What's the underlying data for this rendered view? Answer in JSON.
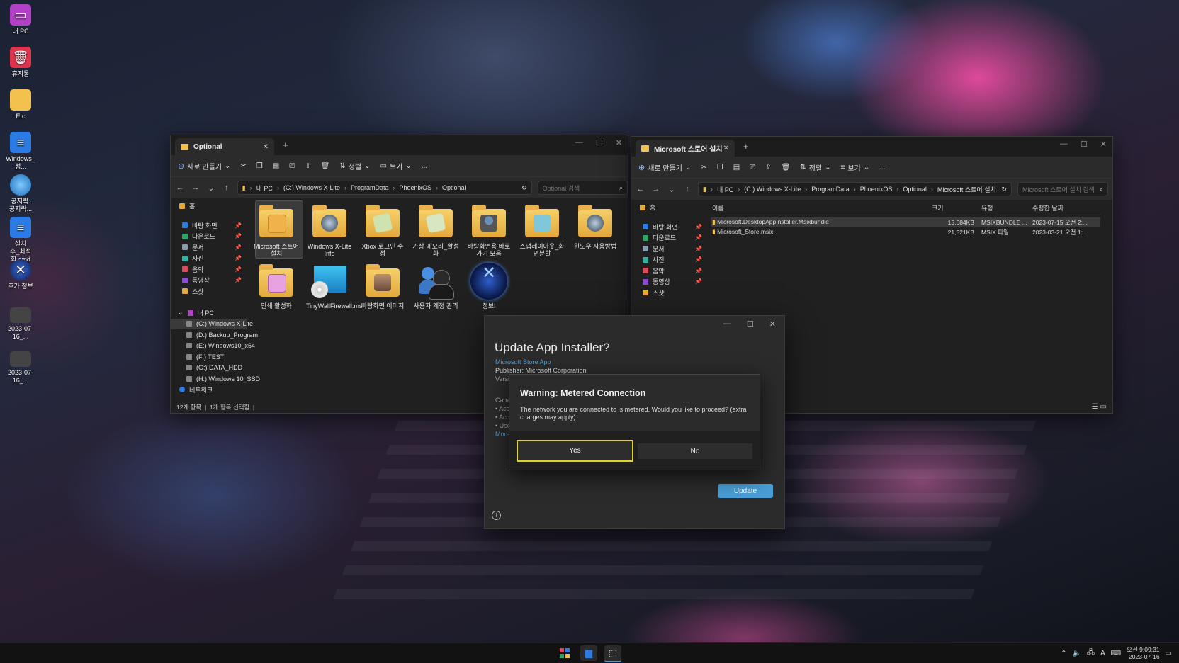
{
  "desktop_icons": [
    {
      "label": "내 PC",
      "icon": "monitor-icon"
    },
    {
      "label": "휴지통",
      "icon": "recycle-bin-icon"
    },
    {
      "label": "Etc",
      "icon": "folder-icon"
    },
    {
      "label": "Windows_정...",
      "icon": "document-icon"
    },
    {
      "label": "공지락.\n공지락...",
      "icon": "globe-icon"
    },
    {
      "label": "설치\n후_최적화.cmd",
      "icon": "document-icon"
    },
    {
      "label": "추가 정보",
      "icon": "info-badge-icon"
    },
    {
      "label": "2023-07-16_...",
      "icon": "screenshot-icon"
    },
    {
      "label": "2023-07-16_...",
      "icon": "screenshot-icon"
    }
  ],
  "left_window": {
    "tab_title": "Optional",
    "toolbar": {
      "new": "새로 만들기",
      "sort": "정렬",
      "view": "보기",
      "more": "..."
    },
    "breadcrumb": [
      "내 PC",
      "(C:) Windows X-Lite",
      "ProgramData",
      "PhoenixOS",
      "Optional"
    ],
    "search_placeholder": "Optional 검색",
    "sidebar": {
      "home": "홈",
      "quick": [
        "바탕 화면",
        "다운로드",
        "문서",
        "사진",
        "음악",
        "동영상",
        "스샷"
      ],
      "pc": "내 PC",
      "drives": [
        "(C:) Windows X-Lite",
        "(D:) Backup_Program",
        "(E:) Windows10_x64",
        "(F:) TEST",
        "(G:) DATA_HDD",
        "(H:) Windows 10_SSD"
      ],
      "network": "네트워크"
    },
    "items": [
      "Microsoft 스토어 설치",
      "Windows X-Lite Info",
      "Xbox 로그인 수정",
      "가상 메모리_활성화",
      "바탕화면용 바로가기 모음",
      "스냅레이아웃_화면분할",
      "윈도우 사용방법",
      "인쇄 활성화",
      "TinyWallFirewall.msi",
      "바탕화면 이미지",
      "사용자 계정 관리",
      "정보!"
    ],
    "status": {
      "count": "12개 항목",
      "selected": "1개 항목 선택함"
    }
  },
  "right_window": {
    "tab_title": "Microsoft 스토어 설치",
    "toolbar": {
      "new": "새로 만들기",
      "sort": "정렬",
      "view": "보기",
      "more": "..."
    },
    "breadcrumb": [
      "내 PC",
      "(C:) Windows X-Lite",
      "ProgramData",
      "PhoenixOS",
      "Optional",
      "Microsoft 스토어 설치"
    ],
    "search_placeholder": "Microsoft 스토어 설치 검색",
    "sidebar": {
      "home": "홈",
      "quick": [
        "바탕 화면",
        "다운로드",
        "문서",
        "사진",
        "음악",
        "동영상",
        "스샷"
      ]
    },
    "columns": [
      "이름",
      "크기",
      "유형",
      "수정한 날짜"
    ],
    "rows": [
      {
        "name": "Microsoft.DesktopAppInstaller.Msixbundle",
        "size": "15,684KB",
        "type": "MSIXBUNDLE ...",
        "date": "2023-07-15 오전 2:..."
      },
      {
        "name": "Microsoft_Store.msix",
        "size": "21,521KB",
        "type": "MSIX 파일",
        "date": "2023-03-21 오전 1:..."
      }
    ]
  },
  "installer": {
    "title": "Update App Installer?",
    "link": "Microsoft Store App",
    "publisher": "Publisher: Microsoft Corporation",
    "clipped": [
      "Versi",
      "Capa",
      "• Acc",
      "• Acc",
      "• Use",
      "More"
    ],
    "update_label": "Update"
  },
  "warning": {
    "title": "Warning: Metered Connection",
    "body": "The network you are connected to is metered. Would you like to proceed? (extra charges may apply).",
    "yes": "Yes",
    "no": "No"
  },
  "taskbar": {
    "time": "오전 9:09:31",
    "date": "2023-07-16",
    "ime": "A"
  },
  "colors": {
    "accent": "#4a9ed6",
    "focus_ring": "#e0d22a",
    "folder": "#f2c14e"
  }
}
